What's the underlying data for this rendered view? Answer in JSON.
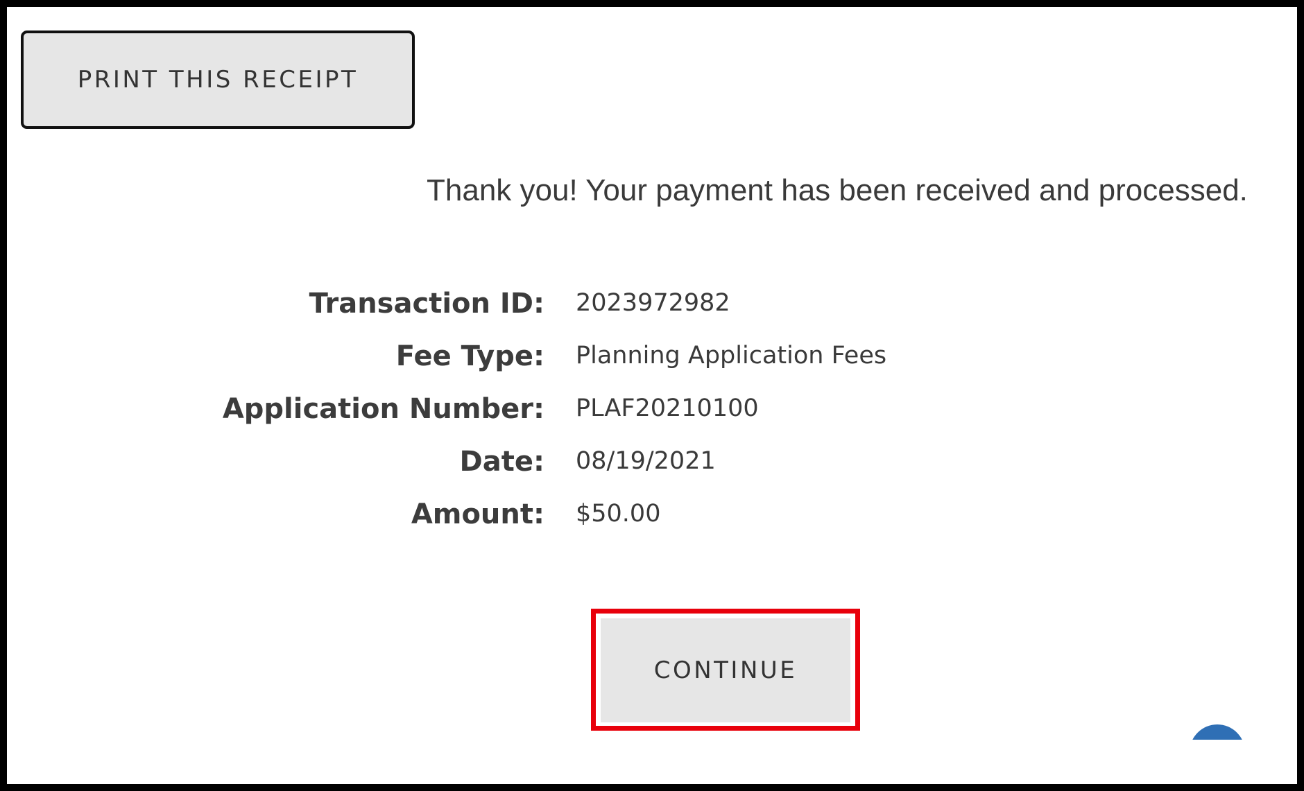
{
  "toolbar": {
    "print_label": "PRINT THIS RECEIPT"
  },
  "message": {
    "confirmation": "Thank you! Your payment has been received and processed."
  },
  "receipt": {
    "rows": [
      {
        "label": "Transaction ID:",
        "value": "2023972982"
      },
      {
        "label": "Fee Type:",
        "value": "Planning Application Fees"
      },
      {
        "label": "Application Number:",
        "value": "PLAF20210100"
      },
      {
        "label": "Date:",
        "value": "08/19/2021"
      },
      {
        "label": "Amount:",
        "value": "$50.00"
      }
    ]
  },
  "actions": {
    "continue_label": "CONTINUE"
  },
  "colors": {
    "highlight": "#e8000b",
    "button_bg": "#e6e6e6",
    "chat_widget": "#2f6fb5"
  },
  "icons": {
    "chat_widget": "chat-bubble-icon"
  }
}
